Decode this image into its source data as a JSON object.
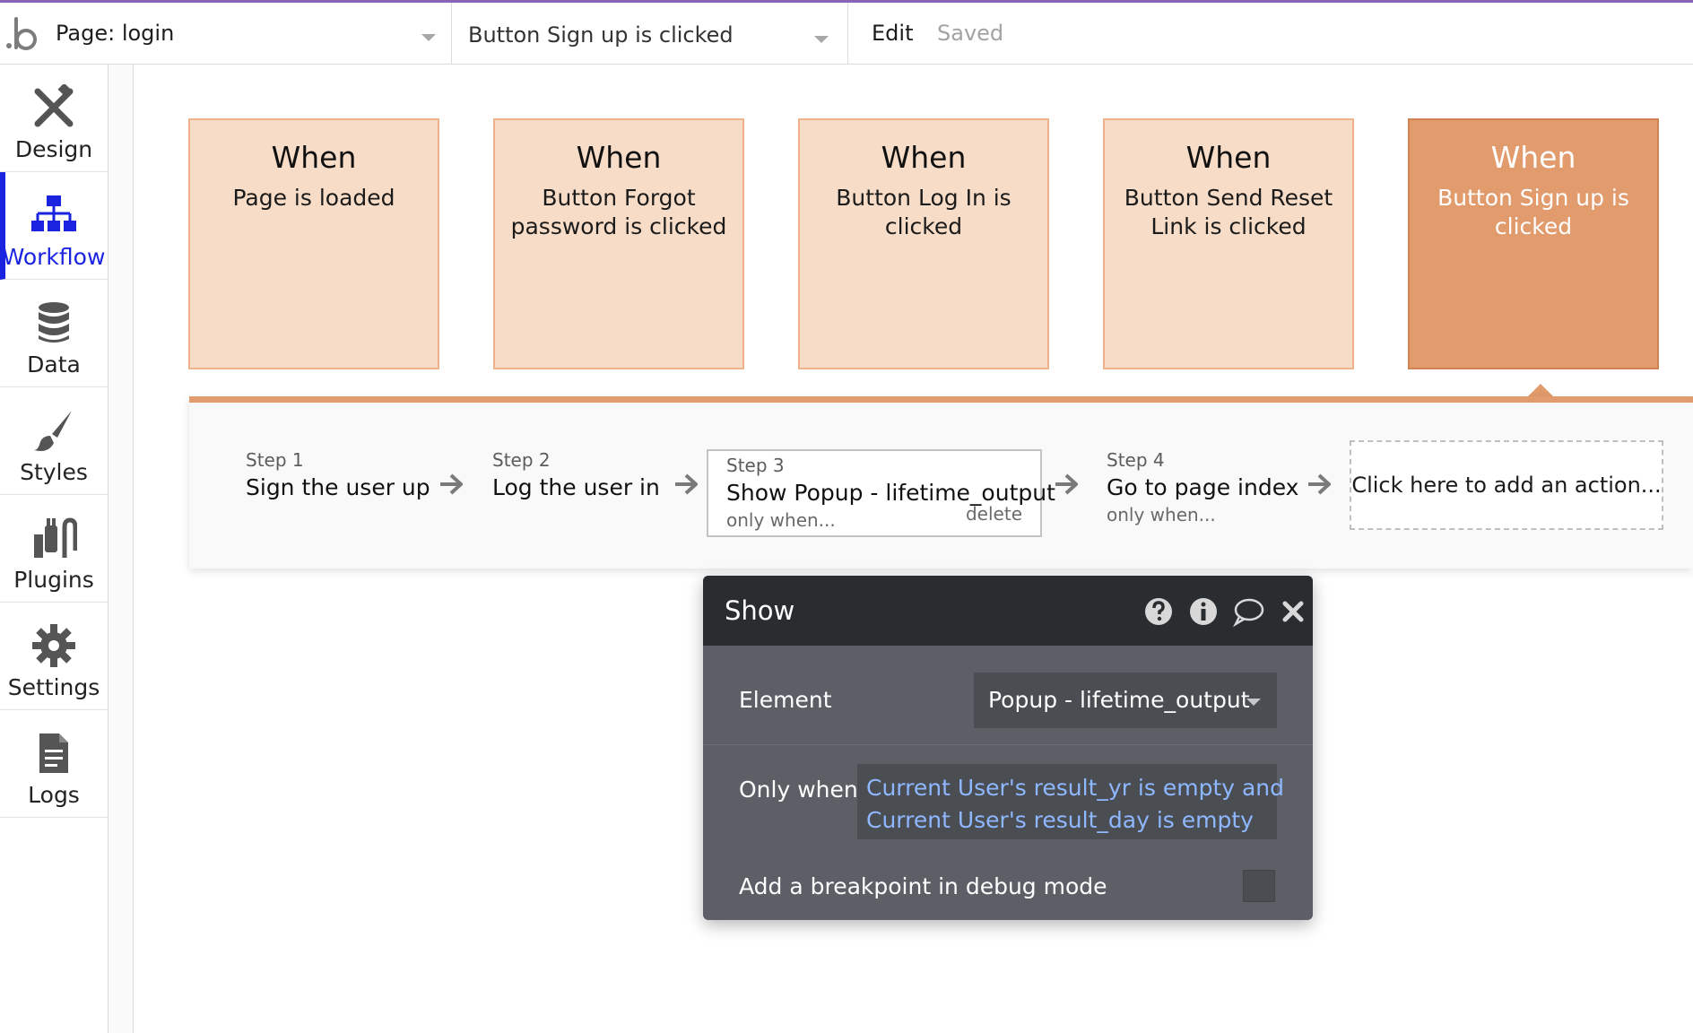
{
  "topbar": {
    "page_label": "Page: login",
    "event_label": "Button Sign up is clicked",
    "edit_label": "Edit",
    "saved_label": "Saved"
  },
  "sidebar": {
    "items": [
      {
        "label": "Design",
        "icon": "design-icon"
      },
      {
        "label": "Workflow",
        "icon": "workflow-icon",
        "active": true
      },
      {
        "label": "Data",
        "icon": "database-icon"
      },
      {
        "label": "Styles",
        "icon": "brush-icon"
      },
      {
        "label": "Plugins",
        "icon": "plug-icon"
      },
      {
        "label": "Settings",
        "icon": "gear-icon"
      },
      {
        "label": "Logs",
        "icon": "document-icon"
      }
    ]
  },
  "events": [
    {
      "when": "When",
      "desc": "Page is loaded"
    },
    {
      "when": "When",
      "desc": "Button Forgot password is clicked"
    },
    {
      "when": "When",
      "desc": "Button Log In is clicked"
    },
    {
      "when": "When",
      "desc": "Button Send Reset Link is clicked"
    },
    {
      "when": "When",
      "desc": "Button Sign up is clicked",
      "selected": true
    }
  ],
  "steps": [
    {
      "num": "Step 1",
      "name": "Sign the user up"
    },
    {
      "num": "Step 2",
      "name": "Log the user in"
    },
    {
      "num": "Step 3",
      "name": "Show Popup - lifetime_output",
      "condition": "only when...",
      "delete": "delete"
    },
    {
      "num": "Step 4",
      "name": "Go to page index",
      "condition": "only when..."
    }
  ],
  "add_action_label": "Click here to add an action...",
  "panel": {
    "title": "Show",
    "element_label": "Element",
    "element_value": "Popup - lifetime_output",
    "only_when_label": "Only when",
    "condition_lines": [
      "Current User's result_yr is empty and",
      "Current User's result_day is empty"
    ],
    "breakpoint_label": "Add a breakpoint in debug mode",
    "breakpoint_checked": false
  },
  "colors": {
    "accent_bar": "#8a64b8",
    "active_nav": "#1a23e0",
    "event_card": "#f7dcc7",
    "event_selected": "#e19b6c",
    "condition_text": "#8fb7ff"
  }
}
